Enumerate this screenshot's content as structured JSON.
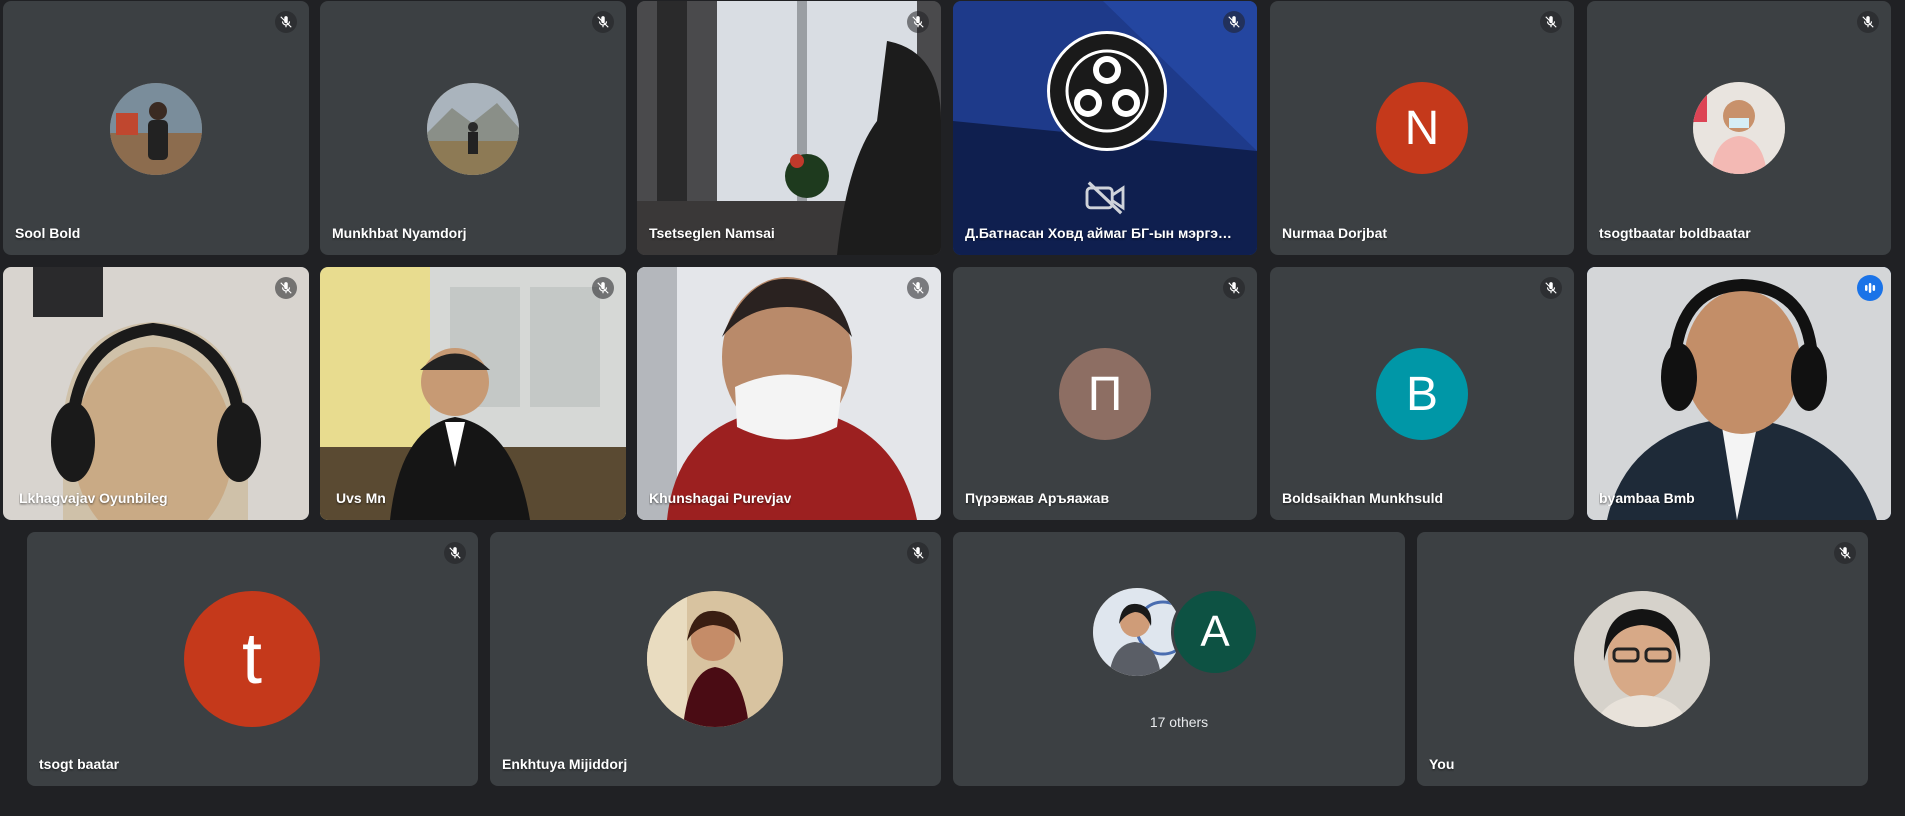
{
  "participants": {
    "sool_bold": {
      "name": "Sool Bold"
    },
    "munkhbat": {
      "name": "Munkhbat Nyamdorj"
    },
    "tsetseglen": {
      "name": "Tsetseglen Namsai"
    },
    "batnasan": {
      "name": "Д.Батнасан Ховд аймаг БГ-ын мэргэж..."
    },
    "nurmaa": {
      "name": "Nurmaa Dorjbat",
      "initial": "N",
      "color": "#c5391b"
    },
    "tsogtbaatar_b": {
      "name": "tsogtbaatar boldbaatar"
    },
    "lkhagvajav": {
      "name": "Lkhagvajav Oyunbileg"
    },
    "uvs": {
      "name": "Uvs Mn"
    },
    "khunshagai": {
      "name": "Khunshagai Purevjav"
    },
    "purevjav": {
      "name": "Пүрэвжав Аръяажав",
      "initial": "П",
      "color": "#8d6e63"
    },
    "boldsaikhan": {
      "name": "Boldsaikhan Munkhsuld",
      "initial": "B",
      "color": "#0097a7"
    },
    "byambaa": {
      "name": "byambaa Bmb"
    },
    "tsogt": {
      "name": "tsogt baatar",
      "initial": "t",
      "color": "#c5391b"
    },
    "enkhtuya": {
      "name": "Enkhtuya Mijiddorj"
    },
    "others": {
      "label": "17 others",
      "initial": "A",
      "color": "#0d5243"
    },
    "you": {
      "name": "You"
    }
  },
  "colors": {
    "background": "#202124",
    "tile": "#3c4043",
    "active_border": "#8ab4f8",
    "speaking": "#1a73e8"
  }
}
